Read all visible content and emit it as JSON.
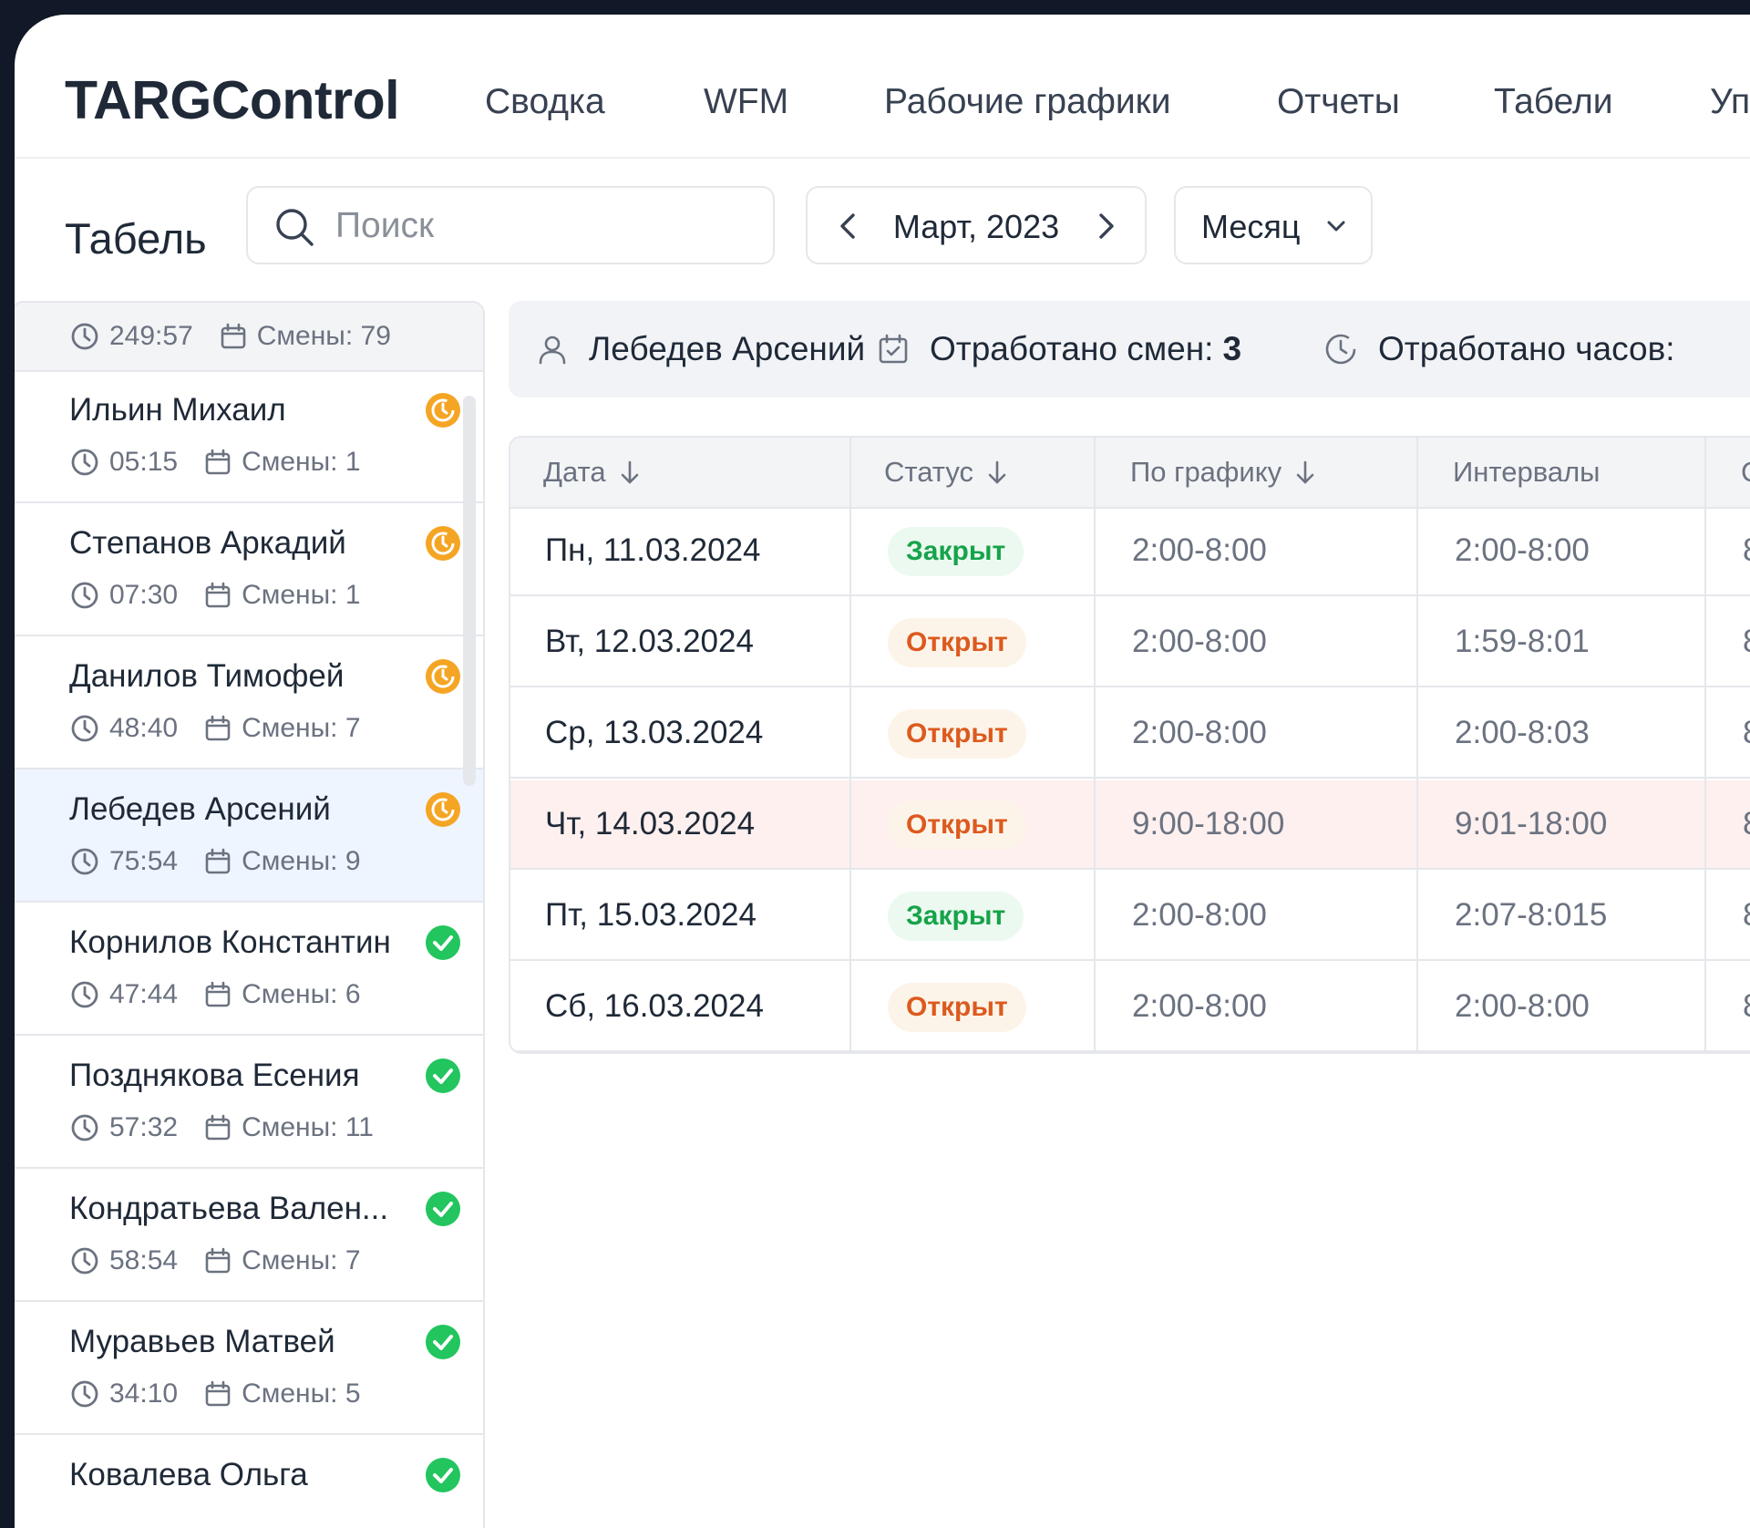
{
  "app": {
    "brand": "TARGControl"
  },
  "nav": [
    {
      "label": "Сводка"
    },
    {
      "label": "WFM"
    },
    {
      "label": "Рабочие графики"
    },
    {
      "label": "Отчеты"
    },
    {
      "label": "Табели"
    },
    {
      "label": "Уп"
    }
  ],
  "toolbar": {
    "title": "Табель",
    "search_placeholder": "Поиск",
    "month_label": "Март, 2023",
    "period_label": "Месяц"
  },
  "employees_total": {
    "hours": "249:57",
    "shifts": "Смены: 79"
  },
  "employees": [
    {
      "name": "Ильин Михаил",
      "hours": "05:15",
      "shifts": "Смены: 1",
      "status": "pending"
    },
    {
      "name": "Степанов Аркадий",
      "hours": "07:30",
      "shifts": "Смены: 1",
      "status": "pending"
    },
    {
      "name": "Данилов Тимофей",
      "hours": "48:40",
      "shifts": "Смены: 7",
      "status": "pending"
    },
    {
      "name": "Лебедев Арсений",
      "hours": "75:54",
      "shifts": "Смены: 9",
      "status": "pending",
      "active": true
    },
    {
      "name": "Корнилов Константин",
      "hours": "47:44",
      "shifts": "Смены: 6",
      "status": "done"
    },
    {
      "name": "Позднякова Есения",
      "hours": "57:32",
      "shifts": "Смены: 11",
      "status": "done"
    },
    {
      "name": "Кондратьева Вален...",
      "hours": "58:54",
      "shifts": "Смены: 7",
      "status": "done"
    },
    {
      "name": "Муравьев Матвей",
      "hours": "34:10",
      "shifts": "Смены: 5",
      "status": "done"
    },
    {
      "name": "Ковалева Ольга",
      "hours": "",
      "shifts": "",
      "status": "done"
    }
  ],
  "summary": {
    "employee": "Лебедев Арсений",
    "shifts_label": "Отработано смен:",
    "shifts_value": "3",
    "hours_label": "Отработано часов:"
  },
  "table": {
    "columns": [
      "Дата",
      "Статус",
      "По графику",
      "Интервалы",
      "С"
    ],
    "rows": [
      {
        "date": "Пн, 11.03.2024",
        "status": "Закрыт",
        "status_type": "closed",
        "schedule": "2:00-8:00",
        "intervals": "2:00-8:00",
        "last": "8"
      },
      {
        "date": "Вт, 12.03.2024",
        "status": "Открыт",
        "status_type": "open",
        "schedule": "2:00-8:00",
        "intervals": "1:59-8:01",
        "last": "8"
      },
      {
        "date": "Ср, 13.03.2024",
        "status": "Открыт",
        "status_type": "open",
        "schedule": "2:00-8:00",
        "intervals": "2:00-8:03",
        "last": "8"
      },
      {
        "date": "Чт, 14.03.2024",
        "status": "Открыт",
        "status_type": "open",
        "schedule": "9:00-18:00",
        "intervals": "9:01-18:00",
        "last": "8",
        "highlight": true
      },
      {
        "date": "Пт, 15.03.2024",
        "status": "Закрыт",
        "status_type": "closed",
        "schedule": "2:00-8:00",
        "intervals": "2:07-8:015",
        "last": "8"
      },
      {
        "date": "Сб, 16.03.2024",
        "status": "Открыт",
        "status_type": "open",
        "schedule": "2:00-8:00",
        "intervals": "2:00-8:00",
        "last": "8"
      }
    ]
  },
  "colors": {
    "frame": "#111827",
    "status_closed": "#16a34a",
    "status_open": "#dc5a1e",
    "pending_icon": "#f5a524",
    "done_icon": "#22c55e",
    "active_row": "#eef5ff",
    "highlight_row": "#fdf0ef"
  }
}
